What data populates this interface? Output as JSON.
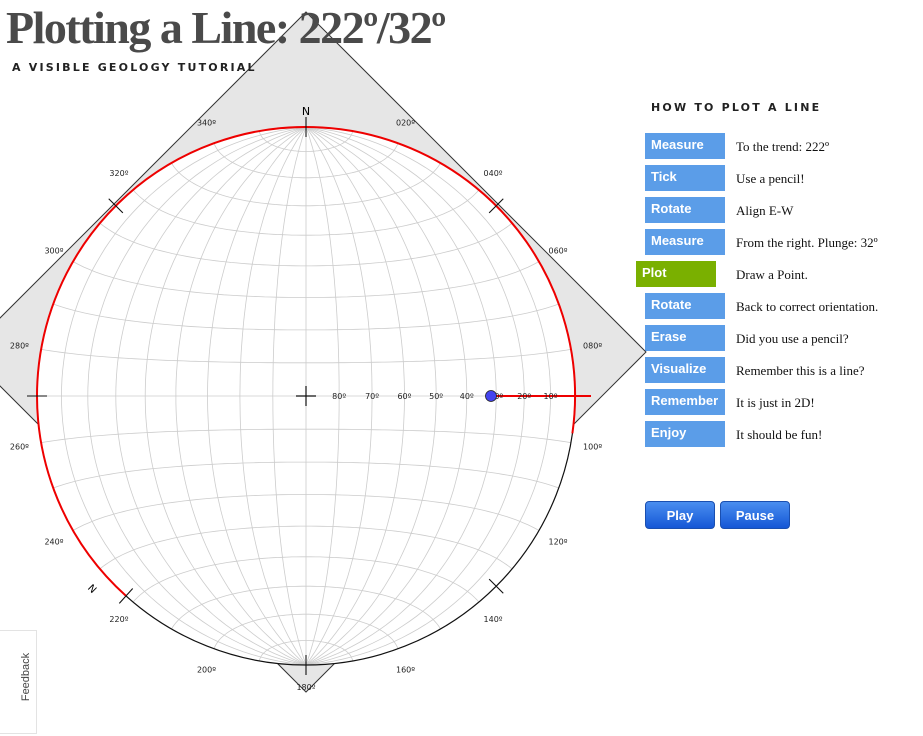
{
  "header": {
    "title": "Plotting a Line: 222º/32º",
    "subtitle": "A VISIBLE GEOLOGY TUTORIAL"
  },
  "net": {
    "north_label": "N",
    "azimuth_labels": [
      "340º",
      "020º",
      "320º",
      "040º",
      "300º",
      "060º",
      "280º",
      "080º",
      "260º",
      "100º",
      "240º",
      "120º",
      "220º",
      "140º",
      "200º",
      "160º",
      "180º"
    ],
    "plunge_labels": [
      "80º",
      "70º",
      "60º",
      "50º",
      "40º",
      "30º",
      "20º",
      "10º"
    ],
    "trend": 222,
    "plunge": 32,
    "colors": {
      "highlight": "#ee0000",
      "point": "#4444ee",
      "grid": "#cccccc",
      "paper": "#e6e6e6"
    }
  },
  "panel": {
    "heading": "HOW TO PLOT A LINE",
    "steps": [
      {
        "label": "Measure",
        "desc": "To the trend: 222º"
      },
      {
        "label": "Tick",
        "desc": "Use a pencil!"
      },
      {
        "label": "Rotate",
        "desc": "Align E-W"
      },
      {
        "label": "Measure",
        "desc": "From the right. Plunge: 32º"
      },
      {
        "label": "Plot",
        "desc": "Draw a Point."
      },
      {
        "label": "Rotate",
        "desc": "Back to correct orientation."
      },
      {
        "label": "Erase",
        "desc": "Did you use a pencil?"
      },
      {
        "label": "Visualize",
        "desc": "Remember this is a line?"
      },
      {
        "label": "Remember",
        "desc": "It is just in 2D!"
      },
      {
        "label": "Enjoy",
        "desc": "It should be fun!"
      }
    ],
    "active_step": 4
  },
  "controls": {
    "play": "Play",
    "pause": "Pause"
  },
  "feedback": "Feedback"
}
